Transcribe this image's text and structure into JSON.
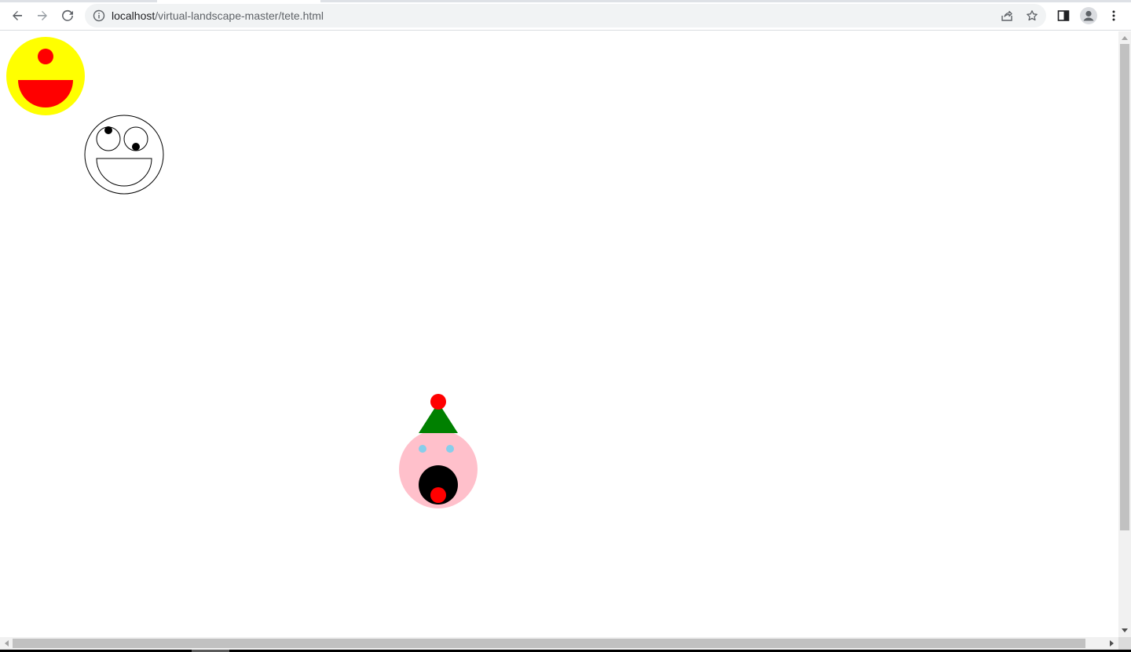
{
  "browser": {
    "url_host": "localhost",
    "url_path": "/virtual-landscape-master/tete.html",
    "icons": {
      "back": "back-arrow-icon",
      "forward": "forward-arrow-icon",
      "reload": "reload-icon",
      "site_info": "info-icon",
      "share": "share-icon",
      "bookmark": "star-icon",
      "side_panel": "side-panel-icon",
      "profile": "profile-icon",
      "menu": "kebab-menu-icon"
    }
  },
  "page": {
    "faces": [
      {
        "name": "yellow-face",
        "colors": {
          "head": "#ffff00",
          "eye": "#ff0000",
          "mouth": "#ff0000"
        }
      },
      {
        "name": "outline-face",
        "colors": {
          "stroke": "#000000",
          "fill": "#ffffff",
          "pupil": "#000000"
        }
      },
      {
        "name": "party-face",
        "colors": {
          "head": "#ffc0cb",
          "eyes": "#87ceeb",
          "mouth": "#000000",
          "tongue": "#ff0000",
          "hat": "#008000",
          "pompom": "#ff0000"
        }
      }
    ]
  },
  "scrollbars": {
    "vertical_position": 0.0,
    "horizontal_position": 0.0
  }
}
